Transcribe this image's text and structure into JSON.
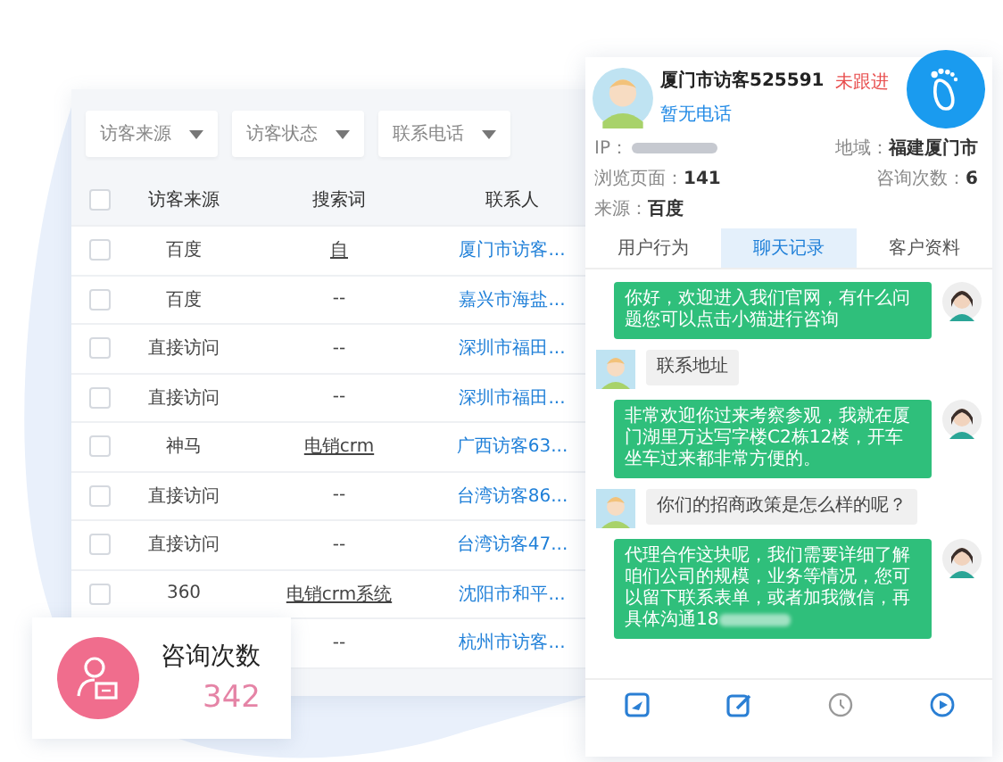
{
  "filters": [
    {
      "label": "访客来源"
    },
    {
      "label": "访客状态"
    },
    {
      "label": "联系电话"
    }
  ],
  "table": {
    "all_checked": false,
    "columns": [
      "访客来源",
      "搜索词",
      "联系人"
    ],
    "rows": [
      {
        "checked": false,
        "source": "百度",
        "keyword": "自",
        "keyword_linked": true,
        "contact": "厦门市访客..."
      },
      {
        "checked": false,
        "source": "百度",
        "keyword": "--",
        "keyword_linked": false,
        "contact": "嘉兴市海盐..."
      },
      {
        "checked": false,
        "source": "直接访问",
        "keyword": "--",
        "keyword_linked": false,
        "contact": "深圳市福田..."
      },
      {
        "checked": false,
        "source": "直接访问",
        "keyword": "--",
        "keyword_linked": false,
        "contact": "深圳市福田..."
      },
      {
        "checked": false,
        "source": "神马",
        "keyword": "电销crm",
        "keyword_linked": true,
        "contact": "广西访客63..."
      },
      {
        "checked": false,
        "source": "直接访问",
        "keyword": "--",
        "keyword_linked": false,
        "contact": "台湾访客86..."
      },
      {
        "checked": false,
        "source": "直接访问",
        "keyword": "--",
        "keyword_linked": false,
        "contact": "台湾访客47..."
      },
      {
        "checked": false,
        "source": "360",
        "keyword": "电销crm系统",
        "keyword_linked": true,
        "contact": "沈阳市和平..."
      },
      {
        "keyword": "--",
        "keyword_linked": false,
        "contact": "杭州市访客..."
      }
    ]
  },
  "stat_card": {
    "label": "咨询次数",
    "value": "342"
  },
  "visitor": {
    "name": "厦门市访客525591",
    "phone": "暂无电话",
    "status": "未跟进",
    "info": [
      {
        "kind": "blurred",
        "label": "IP："
      },
      {
        "kind": "text",
        "label": "地域：",
        "value": "福建厦门市"
      },
      {
        "kind": "text",
        "label": "浏览页面：",
        "value": "141"
      },
      {
        "kind": "text",
        "label": "咨询次数：",
        "value": "6"
      },
      {
        "kind": "text",
        "label": "来源：",
        "value": "百度"
      }
    ]
  },
  "tabs": [
    {
      "label": "用户行为",
      "selected": false
    },
    {
      "label": "聊天记录",
      "selected": true
    },
    {
      "label": "客户资料",
      "selected": false
    }
  ],
  "messages": [
    {
      "kind": "agent",
      "text": "你好，欢迎进入我们官网，有什么问题您可以点击小猫进行咨询",
      "blurred_tail": false
    },
    {
      "kind": "visitor",
      "text": "联系地址",
      "blurred_tail": false
    },
    {
      "kind": "agent",
      "text": "非常欢迎你过来考察参观，我就在厦门湖里万达写字楼C2栋12楼，开车坐车过来都非常方便的。",
      "blurred_tail": false
    },
    {
      "kind": "visitor",
      "text": "你们的招商政策是怎么样的呢？",
      "blurred_tail": false
    },
    {
      "kind": "agent",
      "text": "代理合作这块呢，我们需要详细了解咱们公司的规模，业务等情况，您可以留下联系表单，或者加我微信，再具体沟通18",
      "blurred_tail": true
    }
  ]
}
